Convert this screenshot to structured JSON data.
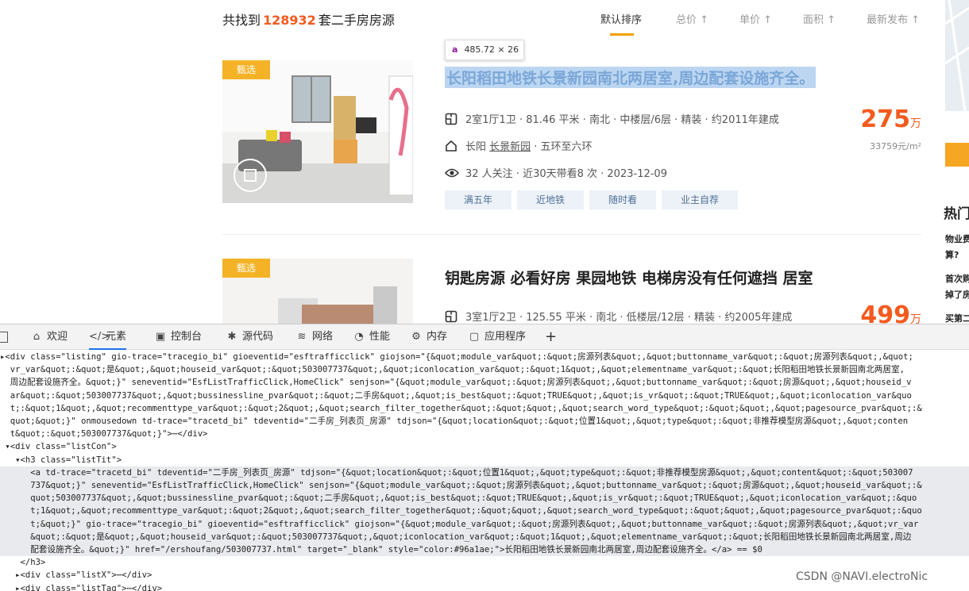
{
  "summary": {
    "prefix": "共找到",
    "count": "128932",
    "suffix": "套二手房房源"
  },
  "sort": [
    {
      "label": "默认排序",
      "active": true
    },
    {
      "label": "总价 ↑",
      "active": false
    },
    {
      "label": "单价 ↑",
      "active": false
    },
    {
      "label": "面积 ↑",
      "active": false
    },
    {
      "label": "最新发布 ↑",
      "active": false
    }
  ],
  "inspect_tooltip": {
    "tag": "a",
    "size": "485.72 × 26"
  },
  "listings": [
    {
      "badge": "甄选",
      "title": "长阳稻田地铁长景新园南北两居室,周边配套设施齐全。",
      "info": "2室1厅1卫 · 81.46 平米 · 南北 · 中楼层/6层 · 精装 · 约2011年建成",
      "location_prefix": "长阳 ",
      "location_link": "长景新园",
      "location_suffix": " · 五环至六环",
      "follow": "32 人关注 · 近30天带看8 次 · 2023-12-09",
      "price": "275",
      "price_unit": "万",
      "unit_price": "33759元/m²",
      "tags": [
        "满五年",
        "近地铁",
        "随时看",
        "业主自荐"
      ]
    },
    {
      "badge": "甄选",
      "title": "钥匙房源 必看好房 果园地铁 电梯房没有任何遮挡 居室",
      "info": "3室1厅2卫 · 125.55 平米 · 南北 · 低楼层/12层 · 精装 · 约2005年建成",
      "price": "499",
      "price_unit": "万"
    }
  ],
  "sidebar": {
    "heading": "热门",
    "lines": [
      "物业费",
      "算?",
      "首次购",
      "掉了房",
      "买第二"
    ]
  },
  "devtools": {
    "tabs": [
      {
        "icon": "home-icon",
        "label": "欢迎"
      },
      {
        "icon": "elements-icon",
        "label": "元素"
      },
      {
        "icon": "console-icon",
        "label": "控制台"
      },
      {
        "icon": "sources-icon",
        "label": "源代码"
      },
      {
        "icon": "network-icon",
        "label": "网络"
      },
      {
        "icon": "performance-icon",
        "label": "性能"
      },
      {
        "icon": "memory-icon",
        "label": "内存"
      },
      {
        "icon": "application-icon",
        "label": "应用程序"
      },
      {
        "icon": "plus-icon",
        "label": "+"
      }
    ],
    "active_tab": "元素",
    "code_lines": [
      "▸<div class=\"listing\" gio-trace=\"tracegio_bi\" gioeventid=\"esftrafficclick\" giojson=\"{&quot;module_var&quot;:&quot;房源列表&quot;,&quot;buttonname_var&quot;:&quot;房源列表&quot;,&quot;",
      "  vr_var&quot;:&quot;是&quot;,&quot;houseid_var&quot;:&quot;503007737&quot;,&quot;iconlocation_var&quot;:&quot;1&quot;,&quot;elementname_var&quot;:&quot;长阳稻田地铁长景新园南北两居室,",
      "  周边配套设施齐全。&quot;}\" seneventid=\"EsfListTrafficClick,HomeClick\" senjson=\"{&quot;module_var&quot;:&quot;房源列表&quot;,&quot;buttonname_var&quot;:&quot;房源&quot;,&quot;houseid_v",
      "  ar&quot;:&quot;503007737&quot;,&quot;bussinessline_pvar&quot;:&quot;二手房&quot;,&quot;is_best&quot;:&quot;TRUE&quot;,&quot;is_vr&quot;:&quot;TRUE&quot;,&quot;iconlocation_var&quo",
      "  t;:&quot;1&quot;,&quot;recommenttype_var&quot;:&quot;2&quot;,&quot;search_filter_together&quot;:&quot;&quot;,&quot;search_word_type&quot;:&quot;&quot;,&quot;pagesource_pvar&quot;:&",
      "  quot;&quot;}\" onmousedown td-trace=\"tracetd_bi\" tdeventid=\"二手房_列表页_房源\" tdjson=\"{&quot;location&quot;:&quot;位置1&quot;,&quot;type&quot;:&quot;非推荐模型房源&quot;,&quot;conten",
      "  t&quot;:&quot;503007737&quot;}\">⋯</div>",
      " ▾<div class=\"listCon\">",
      "   ▾<h3 class=\"listTit\">",
      "      <a td-trace=\"tracetd_bi\" tdeventid=\"二手房_列表页_房源\" tdjson=\"{&quot;location&quot;:&quot;位置1&quot;,&quot;type&quot;:&quot;非推荐模型房源&quot;,&quot;content&quot;:&quot;503007",
      "      737&quot;}\" seneventid=\"EsfListTrafficClick,HomeClick\" senjson=\"{&quot;module_var&quot;:&quot;房源列表&quot;,&quot;buttonname_var&quot;:&quot;房源&quot;,&quot;houseid_var&quot;:&",
      "      quot;503007737&quot;,&quot;bussinessline_pvar&quot;:&quot;二手房&quot;,&quot;is_best&quot;:&quot;TRUE&quot;,&quot;is_vr&quot;:&quot;TRUE&quot;,&quot;iconlocation_var&quot;:&quo",
      "      t;1&quot;,&quot;recommenttype_var&quot;:&quot;2&quot;,&quot;search_filter_together&quot;:&quot;&quot;,&quot;search_word_type&quot;:&quot;&quot;,&quot;pagesource_pvar&quot;:&quo",
      "      t;&quot;}\" gio-trace=\"tracegio_bi\" gioeventid=\"esftrafficclick\" giojson=\"{&quot;module_var&quot;:&quot;房源列表&quot;,&quot;buttonname_var&quot;:&quot;房源列表&quot;,&quot;vr_var",
      "      &quot;:&quot;是&quot;,&quot;houseid_var&quot;:&quot;503007737&quot;,&quot;iconlocation_var&quot;:&quot;1&quot;,&quot;elementname_var&quot;:&quot;长阳稻田地铁长景新园南北两居室,周边",
      "      配套设施齐全。&quot;}\" href=\"/ershoufang/503007737.html\" target=\"_blank\" style=\"color:#96a1ae;\">长阳稻田地铁长景新园南北两居室,周边配套设施齐全。</a> == $0",
      "    </h3>",
      "   ▸<div class=\"listX\">⋯</div>",
      "   ▸<div class=\"listTag\">⋯</div>"
    ],
    "selected_line_start": 9,
    "selected_line_end": 15,
    "watermark": "CSDN @NAVI.electroNic"
  }
}
